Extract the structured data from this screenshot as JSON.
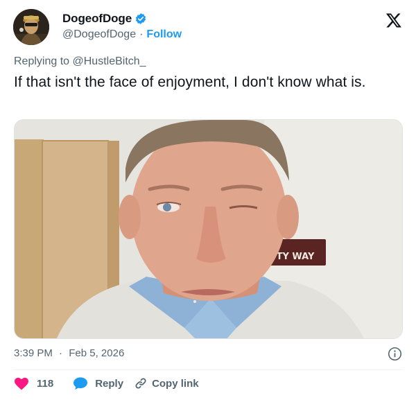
{
  "author": {
    "display_name": "DogeofDoge",
    "handle": "@DogeofDoge",
    "separator": "·",
    "follow_label": "Follow",
    "verified": true
  },
  "reply_context": {
    "prefix": "Replying to",
    "mention": "@HustleBitch_"
  },
  "tweet": {
    "text": "If that isn't the face of enjoyment, I don't know what is.",
    "media_sign_text": "PETTY WAY",
    "time": "3:39 PM",
    "date_separator": "·",
    "date": "Feb 5, 2026"
  },
  "actions": {
    "like_count": "118",
    "reply_label": "Reply",
    "copy_link_label": "Copy link"
  },
  "colors": {
    "accent": "#1d9bf0",
    "like": "#f91880",
    "secondary_text": "#536471",
    "primary_text": "#0f1419"
  },
  "icons": [
    "x-logo-icon",
    "verified-badge-icon",
    "heart-icon",
    "reply-bubble-icon",
    "link-icon",
    "info-icon"
  ]
}
